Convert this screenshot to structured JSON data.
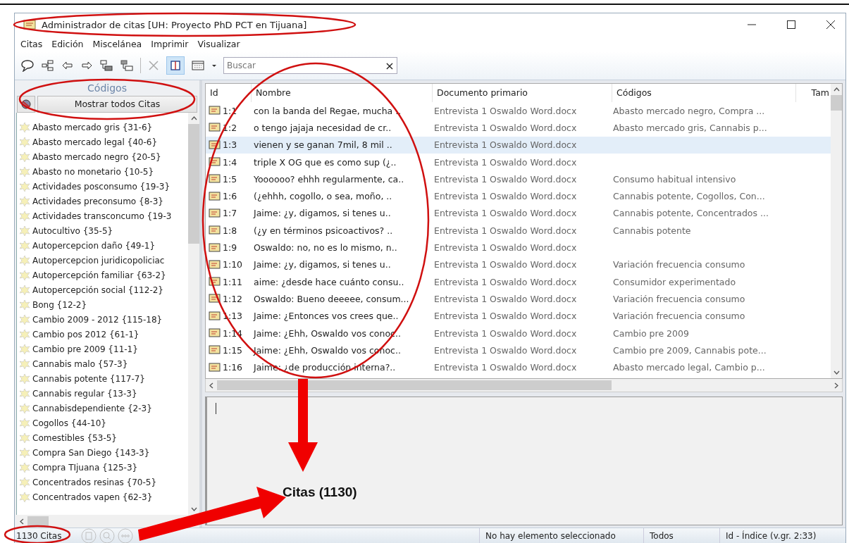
{
  "window": {
    "title": "Administrador de citas [UH: Proyecto PhD PCT en Tijuana]"
  },
  "menu": [
    "Citas",
    "Edición",
    "Miscelánea",
    "Imprimir",
    "Visualizar"
  ],
  "toolbar": {
    "search": {
      "placeholder": "Buscar",
      "clear": "×"
    }
  },
  "codes_panel": {
    "title": "Códigos",
    "show_all_button": "Mostrar todos Citas",
    "items": [
      {
        "label": "Abasto mercado gris {31-6}"
      },
      {
        "label": "Abasto mercado legal {40-6}"
      },
      {
        "label": "Abasto mercado negro {20-5}"
      },
      {
        "label": "Abasto no monetario {10-5}"
      },
      {
        "label": "Actividades posconsumo {19-3}"
      },
      {
        "label": "Actividades preconsumo {8-3}"
      },
      {
        "label": "Actividades transconcumo {19-3"
      },
      {
        "label": "Autocultivo {35-5}"
      },
      {
        "label": "Autopercepcion daño {49-1}"
      },
      {
        "label": "Autopercepcion juridicopoliciac"
      },
      {
        "label": "Autopercepción familiar {63-2}"
      },
      {
        "label": "Autopercepción social {112-2}"
      },
      {
        "label": "Bong {12-2}"
      },
      {
        "label": "Cambio 2009 - 2012 {115-18}"
      },
      {
        "label": "Cambio pos 2012 {61-1}"
      },
      {
        "label": "Cambio pre 2009 {11-1}"
      },
      {
        "label": "Cannabis malo {57-3}"
      },
      {
        "label": "Cannabis potente {117-7}"
      },
      {
        "label": "Cannabis regular {13-3}"
      },
      {
        "label": "Cannabisdependiente {2-3}"
      },
      {
        "label": "Cogollos {44-10}"
      },
      {
        "label": "Comestibles {53-5}"
      },
      {
        "label": "Compra San Diego {143-3}"
      },
      {
        "label": "Compra TIjuana {125-3}"
      },
      {
        "label": "Concentrados resinas {70-5}"
      },
      {
        "label": "Concentrados vapen {62-3}"
      }
    ]
  },
  "table": {
    "columns": [
      "Id",
      "Nombre",
      "Documento primario",
      "Códigos",
      "Tam"
    ],
    "rows": [
      {
        "id": "1:1",
        "name": "con la banda del Regae, mucha ..",
        "document": "Entrevista 1 Oswaldo Word.docx",
        "codes": "Abasto mercado negro, Compra ...",
        "selected": false
      },
      {
        "id": "1:2",
        "name": "o tengo jajaja necesidad de cr..",
        "document": "Entrevista 1 Oswaldo Word.docx",
        "codes": "Abasto mercado gris, Cannabis p...",
        "selected": false
      },
      {
        "id": "1:3",
        "name": "vienen y se ganan 7mil, 8 mil ..",
        "document": "Entrevista 1 Oswaldo Word.docx",
        "selected": true
      },
      {
        "id": "1:4",
        "name": "triple X OG que es como sup (¿..",
        "document": "Entrevista 1 Oswaldo Word.docx",
        "selected": false
      },
      {
        "id": "1:5",
        "name": "Yoooooo? ehhh regularmente, ca..",
        "document": "Entrevista 1 Oswaldo Word.docx",
        "codes": "Consumo habitual intensivo",
        "selected": false
      },
      {
        "id": "1:6",
        "name": "(¿ehhh, cogollo, o sea, moño, ..",
        "document": "Entrevista 1 Oswaldo Word.docx",
        "codes": "Cannabis potente, Cogollos, Con...",
        "selected": false
      },
      {
        "id": "1:7",
        "name": "Jaime: ¿y, digamos, si tenes u..",
        "document": "Entrevista 1 Oswaldo Word.docx",
        "codes": "Cannabis potente, Concentrados ...",
        "selected": false
      },
      {
        "id": "1:8",
        "name": "(¿y en términos psicoactivos? ..",
        "document": "Entrevista 1 Oswaldo Word.docx",
        "codes": "Cannabis potente",
        "selected": false
      },
      {
        "id": "1:9",
        "name": "Oswaldo: no, no es lo mismo, n..",
        "document": "Entrevista 1 Oswaldo Word.docx",
        "selected": false
      },
      {
        "id": "1:10",
        "name": "Jaime: ¿y, digamos, si tenes u..",
        "document": "Entrevista 1 Oswaldo Word.docx",
        "codes": "Variación frecuencia consumo",
        "selected": false
      },
      {
        "id": "1:11",
        "name": "aime: ¿desde hace cuánto consu..",
        "document": "Entrevista 1 Oswaldo Word.docx",
        "codes": "Consumidor experimentado",
        "selected": false
      },
      {
        "id": "1:12",
        "name": "Oswaldo: Bueno deeeee, consum...",
        "document": "Entrevista 1 Oswaldo Word.docx",
        "codes": "Variación frecuencia consumo",
        "selected": false
      },
      {
        "id": "1:13",
        "name": "Jaime: ¿Entonces vos crees que..",
        "document": "Entrevista 1 Oswaldo Word.docx",
        "codes": "Variación frecuencia consumo",
        "selected": false
      },
      {
        "id": "1:14",
        "name": "Jaime: ¿Ehh, Oswaldo vos conoc..",
        "document": "Entrevista 1 Oswaldo Word.docx",
        "codes": "Cambio pre 2009",
        "selected": false
      },
      {
        "id": "1:15",
        "name": "Jaime: ¿Ehh, Oswaldo vos conoc..",
        "document": "Entrevista 1 Oswaldo Word.docx",
        "codes": "Cambio pre 2009, Cannabis pote...",
        "selected": false
      },
      {
        "id": "1:16",
        "name": "Jaime: ¿de producción interna?..",
        "document": "Entrevista 1 Oswaldo Word.docx",
        "codes": "Abasto mercado legal, Cambio p...",
        "selected": false
      }
    ]
  },
  "status_bar": {
    "count": "1130 Citas",
    "selection": "No hay elemento seleccionado",
    "filter": "Todos",
    "sort": "Id - Índice (v.gr. 2:33)"
  },
  "annotation": {
    "label": "Citas (1130)"
  }
}
